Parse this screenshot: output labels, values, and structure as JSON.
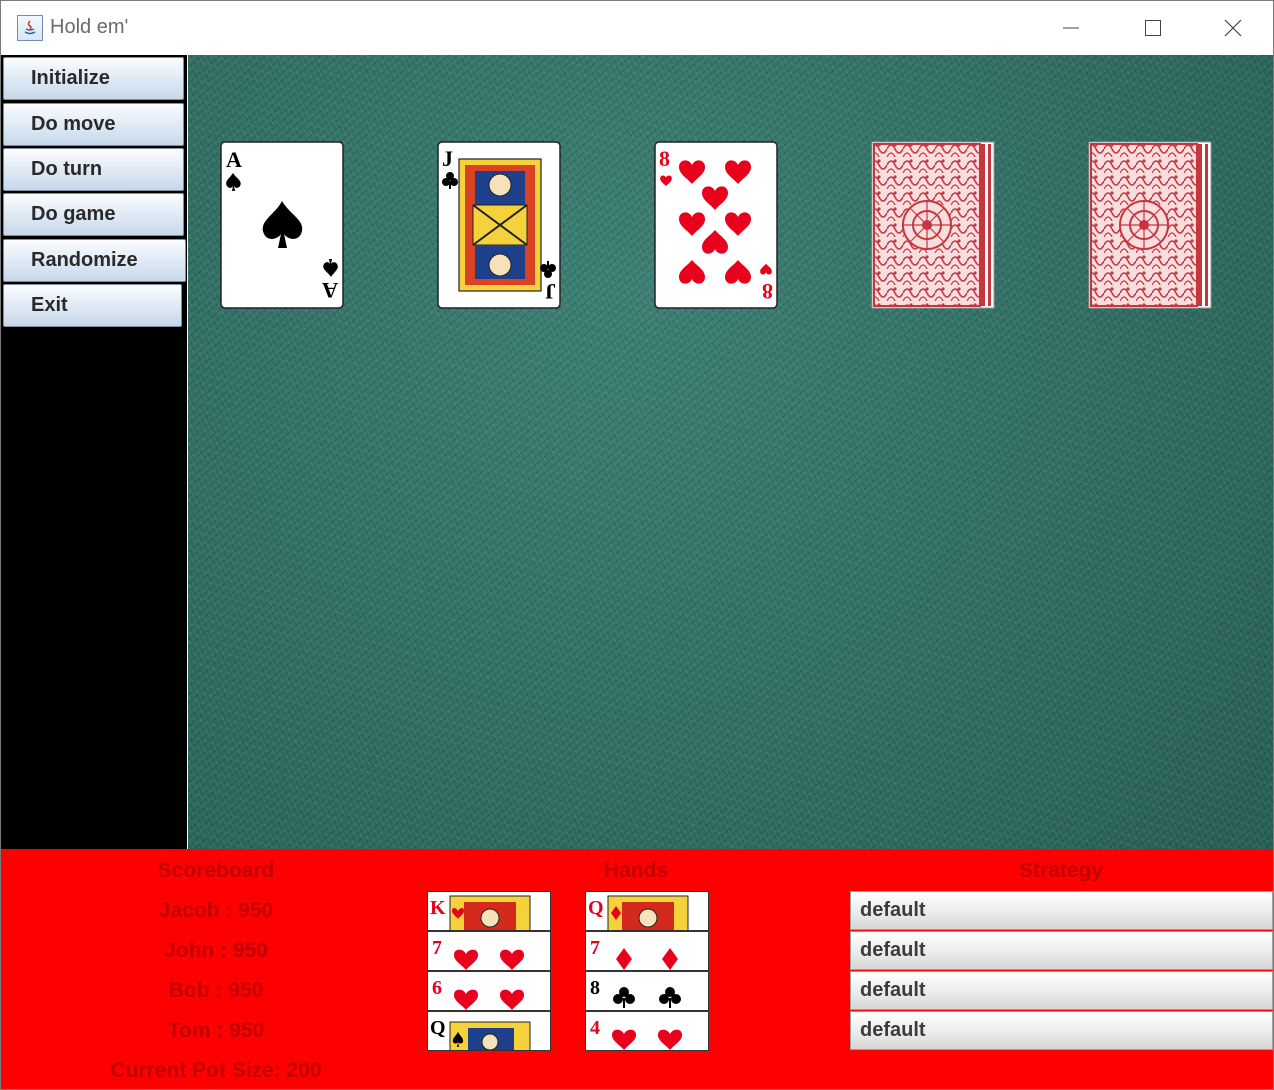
{
  "window": {
    "title": "Hold em'"
  },
  "sidebar": {
    "buttons": [
      {
        "label": "Initialize"
      },
      {
        "label": "Do move"
      },
      {
        "label": "Do turn"
      },
      {
        "label": "Do game"
      },
      {
        "label": "Randomize"
      },
      {
        "label": "Exit"
      }
    ]
  },
  "table": {
    "cards": [
      {
        "rank": "A",
        "suit": "spades",
        "face_up": true
      },
      {
        "rank": "J",
        "suit": "clubs",
        "face_up": true
      },
      {
        "rank": "8",
        "suit": "hearts",
        "face_up": true
      },
      {
        "face_up": false
      },
      {
        "face_up": false
      }
    ]
  },
  "scoreboard": {
    "title": "Scoreboard",
    "lines": [
      "Jacob : 950",
      "John : 950",
      "Bob : 950",
      "Tom : 950"
    ],
    "pot": "Current Pot Size: 200"
  },
  "hands": {
    "title": "Hands",
    "rows": [
      [
        {
          "rank": "K",
          "suit": "hearts"
        },
        {
          "rank": "Q",
          "suit": "diamonds"
        }
      ],
      [
        {
          "rank": "7",
          "suit": "hearts"
        },
        {
          "rank": "7",
          "suit": "diamonds"
        }
      ],
      [
        {
          "rank": "6",
          "suit": "hearts"
        },
        {
          "rank": "8",
          "suit": "clubs"
        }
      ],
      [
        {
          "rank": "Q",
          "suit": "spades"
        },
        {
          "rank": "4",
          "suit": "hearts"
        }
      ]
    ]
  },
  "strategy": {
    "title": "Strategy",
    "values": [
      "default",
      "default",
      "default",
      "default"
    ]
  },
  "colors": {
    "felt": "#2f6d63",
    "bottom_panel": "#ff0000",
    "panel_text": "#c20000",
    "card_red": "#e8001c"
  }
}
